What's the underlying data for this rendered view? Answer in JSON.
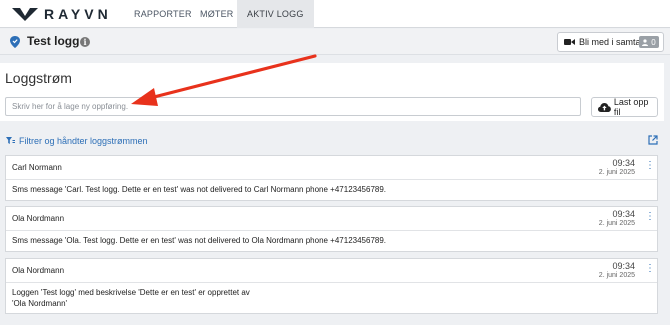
{
  "app": {
    "logo_text": "RAYVN",
    "nav": [
      "RAPPORTER",
      "MØTER",
      "AKTIV LOGG"
    ],
    "active_nav": "AKTIV LOGG"
  },
  "titlebar": {
    "title": "Test logg",
    "join_button": "Bli med i samtale",
    "participant_count": "0"
  },
  "logstream": {
    "heading": "Loggstrøm",
    "placeholder": "Skriv her for å lage ny oppføring.",
    "upload_button": "Last opp fil",
    "filter_link": "Filtrer og håndter loggstrømmen"
  },
  "entries": [
    {
      "author": "Carl Normann",
      "time": "09:34",
      "date": "2. juni 2025",
      "text": "Sms message 'Carl. Test logg. Dette er en test' was not delivered to Carl Normann phone +47123456789."
    },
    {
      "author": "Ola Nordmann",
      "time": "09:34",
      "date": "2. juni 2025",
      "text": "Sms message 'Ola. Test logg. Dette er en test' was not delivered to Ola Nordmann phone +47123456789."
    },
    {
      "author": "Ola Nordmann",
      "time": "09:34",
      "date": "2. juni 2025",
      "text_line1": "Loggen 'Test logg' med beskrivelse 'Dette er en test' er opprettet av",
      "text_line2": "'Ola Nordmann'"
    }
  ],
  "colors": {
    "accent": "#2d6fb7",
    "annotation_arrow": "#e8321c"
  },
  "icons": [
    "rayvn-logo-icon",
    "location-pin-icon",
    "info-icon",
    "video-camera-icon",
    "people-icon",
    "cloud-upload-icon",
    "filter-icon",
    "external-link-icon",
    "kebab-menu-icon"
  ]
}
